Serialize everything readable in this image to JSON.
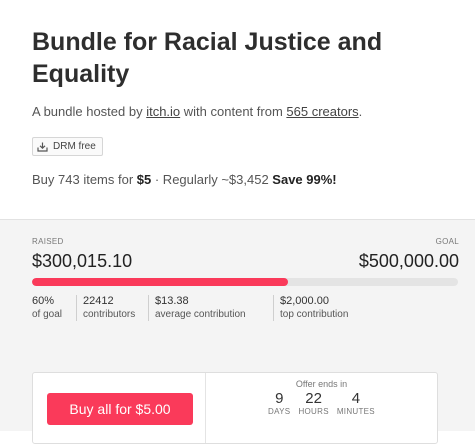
{
  "bundle": {
    "title": "Bundle for Racial Justice and Equality",
    "hosted_prefix": "A bundle hosted by ",
    "host_link": "itch.io",
    "hosted_middle": " with content from ",
    "creators_link": "565 creators",
    "hosted_suffix": ".",
    "drm_label": "DRM free",
    "buy_prefix": "Buy 743 items for ",
    "buy_price": "$5",
    "buy_middle": " · Regularly ~$3,452 ",
    "buy_save": "Save 99%!"
  },
  "funding": {
    "raised_label": "RAISED",
    "goal_label": "GOAL",
    "raised_value": "$300,015.10",
    "goal_value": "$500,000.00",
    "progress_fraction": 0.6,
    "stats": [
      {
        "value": "60%",
        "label": "of goal"
      },
      {
        "value": "22412",
        "label": "contributors"
      },
      {
        "value": "$13.38",
        "label": "average contribution"
      },
      {
        "value": "$2,000.00",
        "label": "top contribution"
      }
    ]
  },
  "purchase": {
    "button_label": "Buy all for $5.00",
    "offer_label": "Offer ends in",
    "countdown": [
      {
        "value": "9",
        "unit": "DAYS"
      },
      {
        "value": "22",
        "unit": "HOURS"
      },
      {
        "value": "4",
        "unit": "MINUTES"
      }
    ]
  },
  "colors": {
    "accent": "#fa3a5a"
  },
  "icons": {
    "drm": "download-tray-icon"
  }
}
